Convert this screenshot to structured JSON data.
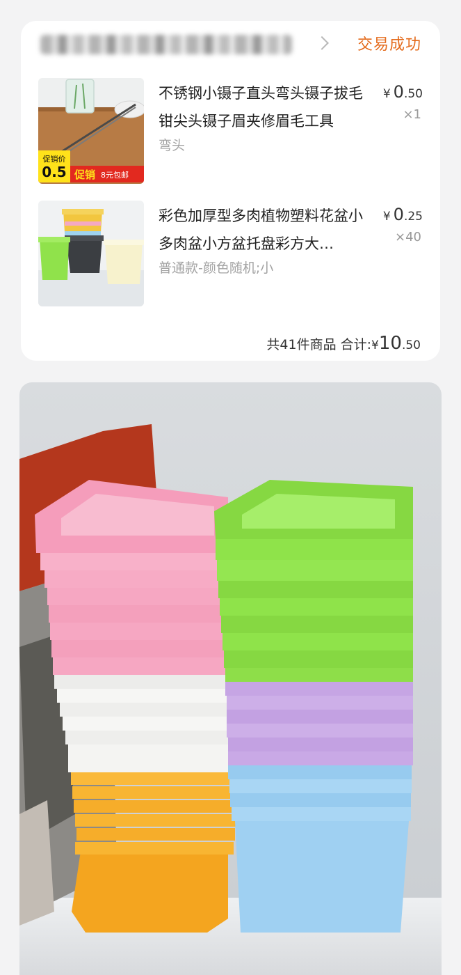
{
  "order": {
    "status": "交易成功",
    "items": [
      {
        "title": "不锈钢小镊子直头弯头镊子拔毛钳尖头镊子眉夹修眉毛工具",
        "sku": "弯头",
        "price_int": "0",
        "price_dec": ".50",
        "qty": "×1",
        "thumb_badge_label": "促销价",
        "thumb_badge_value": "0.5",
        "thumb_banner": "促销",
        "thumb_banner_small": "8元包邮"
      },
      {
        "title": "彩色加厚型多肉植物塑料花盆小多肉盆小方盆托盘彩方大…",
        "sku": "普通款-颜色随机;小",
        "price_int": "0",
        "price_dec": ".25",
        "qty": "×40"
      }
    ],
    "summary": {
      "count_text": "共41件商品",
      "total_label": "合计:",
      "total_int": "10",
      "total_dec": ".50"
    },
    "currency": "¥"
  },
  "colors": {
    "status_orange": "#e46b1c",
    "pink_pot": "#f6a7c2",
    "green_pot": "#8fe34a",
    "white_pot": "#f4f4f2",
    "purple_pot": "#c9a9e6",
    "orange_pot": "#f8b532",
    "blue_pot": "#9fd0f2"
  }
}
